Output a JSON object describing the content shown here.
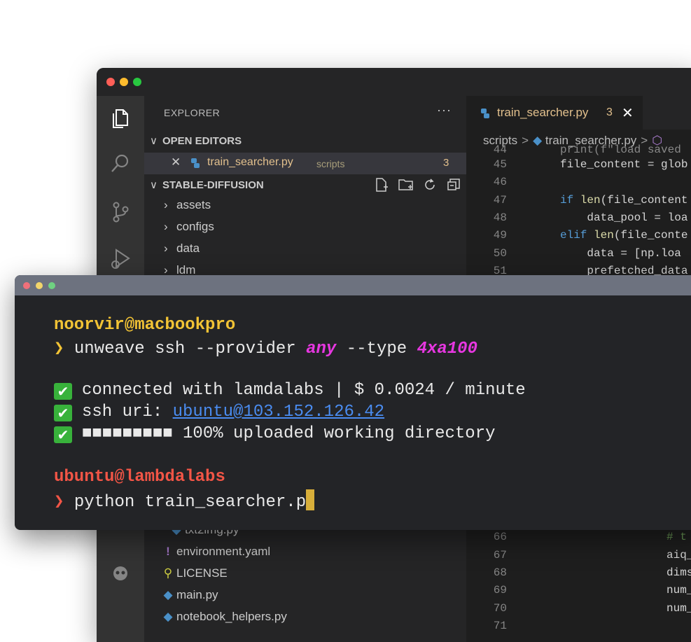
{
  "explorer": {
    "header": "EXPLORER",
    "more": "···",
    "open_editors_label": "OPEN EDITORS",
    "open_editor": {
      "close": "✕",
      "name": "train_searcher.py",
      "path": "scripts",
      "badge": "3"
    },
    "project_label": "STABLE-DIFFUSION",
    "folders": [
      "assets",
      "configs",
      "data",
      "ldm"
    ],
    "files": [
      {
        "name": "txt2img.py",
        "icon": "python-icon"
      },
      {
        "name": "environment.yaml",
        "icon": "yaml-icon"
      },
      {
        "name": "LICENSE",
        "icon": "license-icon"
      },
      {
        "name": "main.py",
        "icon": "python-icon"
      },
      {
        "name": "notebook_helpers.py",
        "icon": "python-icon"
      }
    ]
  },
  "editor": {
    "tab": {
      "name": "train_searcher.py",
      "badge": "3",
      "close": "✕"
    },
    "breadcrumbs": [
      "scripts",
      "train_searcher.py"
    ],
    "lines_top": [
      {
        "num": "44",
        "text": "print(f\"load saved"
      },
      {
        "num": "45",
        "text": "file_content = glob"
      },
      {
        "num": "46",
        "text": ""
      },
      {
        "num": "47",
        "kw": "if",
        "fn": " len",
        "text": "(file_content"
      },
      {
        "num": "48",
        "text": "    data_pool = loa"
      },
      {
        "num": "49",
        "kw": "elif",
        "fn": " len",
        "text": "(file_conte"
      },
      {
        "num": "50",
        "text": "    data = [np.loa"
      },
      {
        "num": "51",
        "text": "    prefetched_data"
      }
    ],
    "lines_bottom": [
      {
        "num": "66",
        "comment": "# t"
      },
      {
        "num": "67",
        "text": "aiq_"
      },
      {
        "num": "68",
        "text": "dims"
      },
      {
        "num": "69",
        "text": "num_"
      },
      {
        "num": "70",
        "text": "num_"
      },
      {
        "num": "71",
        "text": ""
      }
    ]
  },
  "terminal": {
    "user1": "noorvir@macbookpro",
    "prompt": "❯",
    "cmd1": {
      "base": "unweave ssh --provider ",
      "provider": "any",
      "mid": " --type ",
      "type": "4xa100"
    },
    "status": [
      {
        "check": "✔",
        "text": "connected with lamdalabs | $ 0.0024 / minute"
      },
      {
        "check": "✔",
        "prefix": "ssh uri: ",
        "link": "ubuntu@103.152.126.42"
      },
      {
        "check": "✔",
        "text": "■■■■■■■■■ 100% uploaded working directory"
      }
    ],
    "user2": "ubuntu@lambdalabs",
    "cmd2": "python train_searcher.p"
  },
  "colors": {
    "accent_yellow": "#f2c335",
    "accent_red": "#f25546",
    "accent_magenta": "#e737e1",
    "link_blue": "#4a8cf0",
    "check_green": "#38b23b"
  }
}
